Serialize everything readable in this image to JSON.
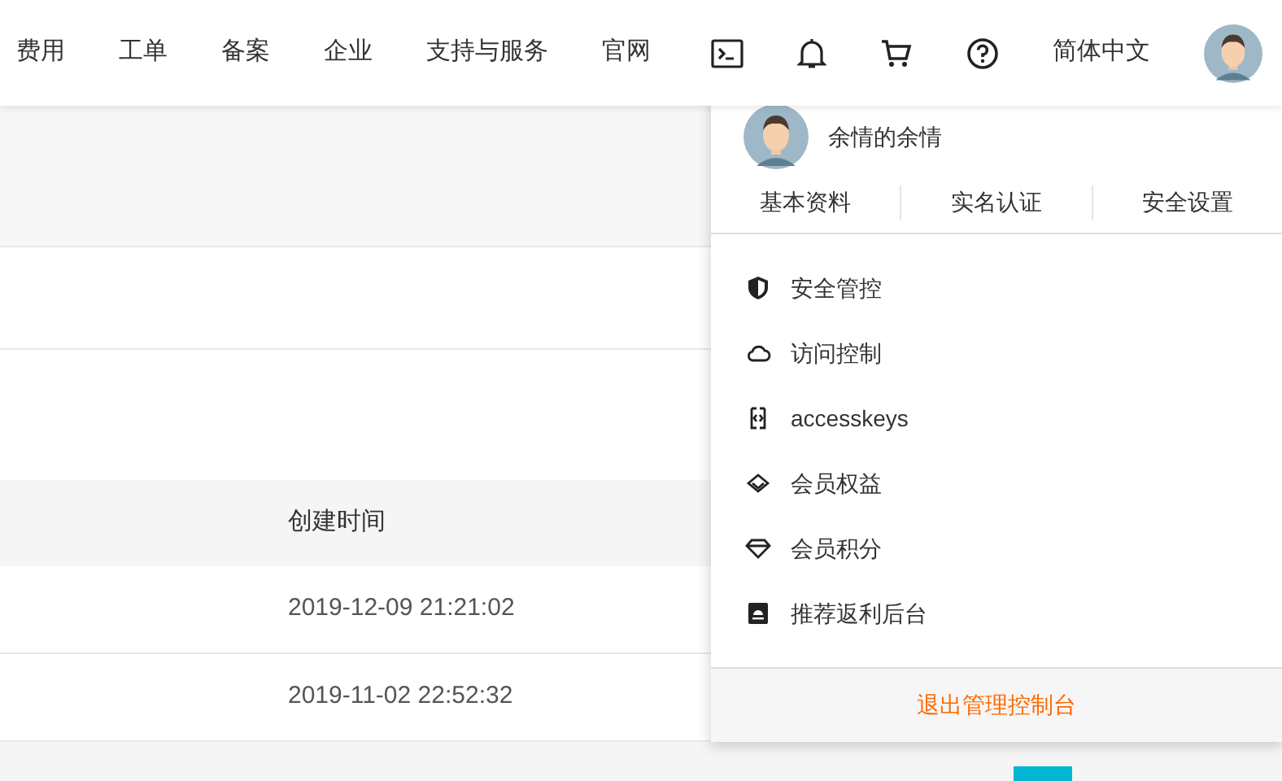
{
  "top_nav": {
    "items": [
      "费用",
      "工单",
      "备案",
      "企业",
      "支持与服务",
      "官网"
    ],
    "language": "简体中文"
  },
  "table": {
    "columns": [
      "创建时间"
    ],
    "rows": [
      "2019-12-09 21:21:02",
      "2019-11-02 22:52:32"
    ]
  },
  "user_menu": {
    "name": "余情的余情",
    "links": [
      "基本资料",
      "实名认证",
      "安全设置"
    ],
    "items": [
      "安全管控",
      "访问控制",
      "accesskeys",
      "会员权益",
      "会员积分",
      "推荐返利后台"
    ],
    "logout": "退出管理控制台"
  }
}
